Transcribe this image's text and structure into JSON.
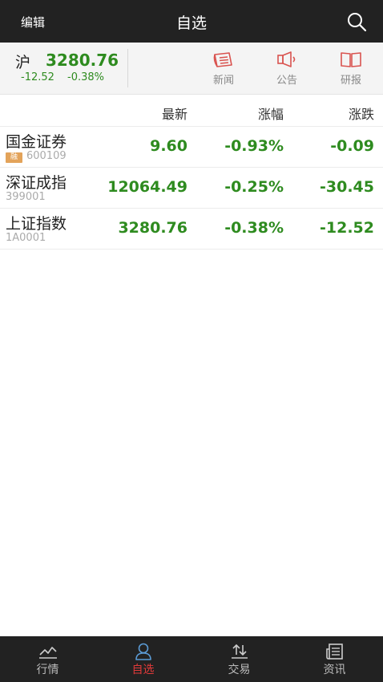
{
  "topbar": {
    "edit_label": "编辑",
    "title": "自选",
    "search_icon": "search-icon"
  },
  "index": {
    "name": "沪",
    "value": "3280.76",
    "change": "-12.52",
    "pct": "-0.38%"
  },
  "quick_actions": [
    {
      "label": "新闻",
      "icon": "news-icon"
    },
    {
      "label": "公告",
      "icon": "megaphone-icon"
    },
    {
      "label": "研报",
      "icon": "book-icon"
    }
  ],
  "columns": {
    "latest": "最新",
    "pct": "涨幅",
    "change": "涨跌"
  },
  "stocks": [
    {
      "name": "国金证券",
      "code": "600109",
      "badge": "融",
      "latest": "9.60",
      "pct": "-0.93%",
      "change": "-0.09"
    },
    {
      "name": "深证成指",
      "code": "399001",
      "latest": "12064.49",
      "pct": "-0.25%",
      "change": "-30.45"
    },
    {
      "name": "上证指数",
      "code": "1A0001",
      "latest": "3280.76",
      "pct": "-0.38%",
      "change": "-12.52"
    }
  ],
  "nav": [
    {
      "label": "行情",
      "icon": "chart-line-icon",
      "active": false
    },
    {
      "label": "自选",
      "icon": "user-icon",
      "active": true
    },
    {
      "label": "交易",
      "icon": "swap-arrows-icon",
      "active": false
    },
    {
      "label": "资讯",
      "icon": "newspaper-icon",
      "active": false
    }
  ],
  "colors": {
    "down_green": "#2e8b1f",
    "accent_red": "#e03a3a",
    "bar_dark": "#222222"
  }
}
